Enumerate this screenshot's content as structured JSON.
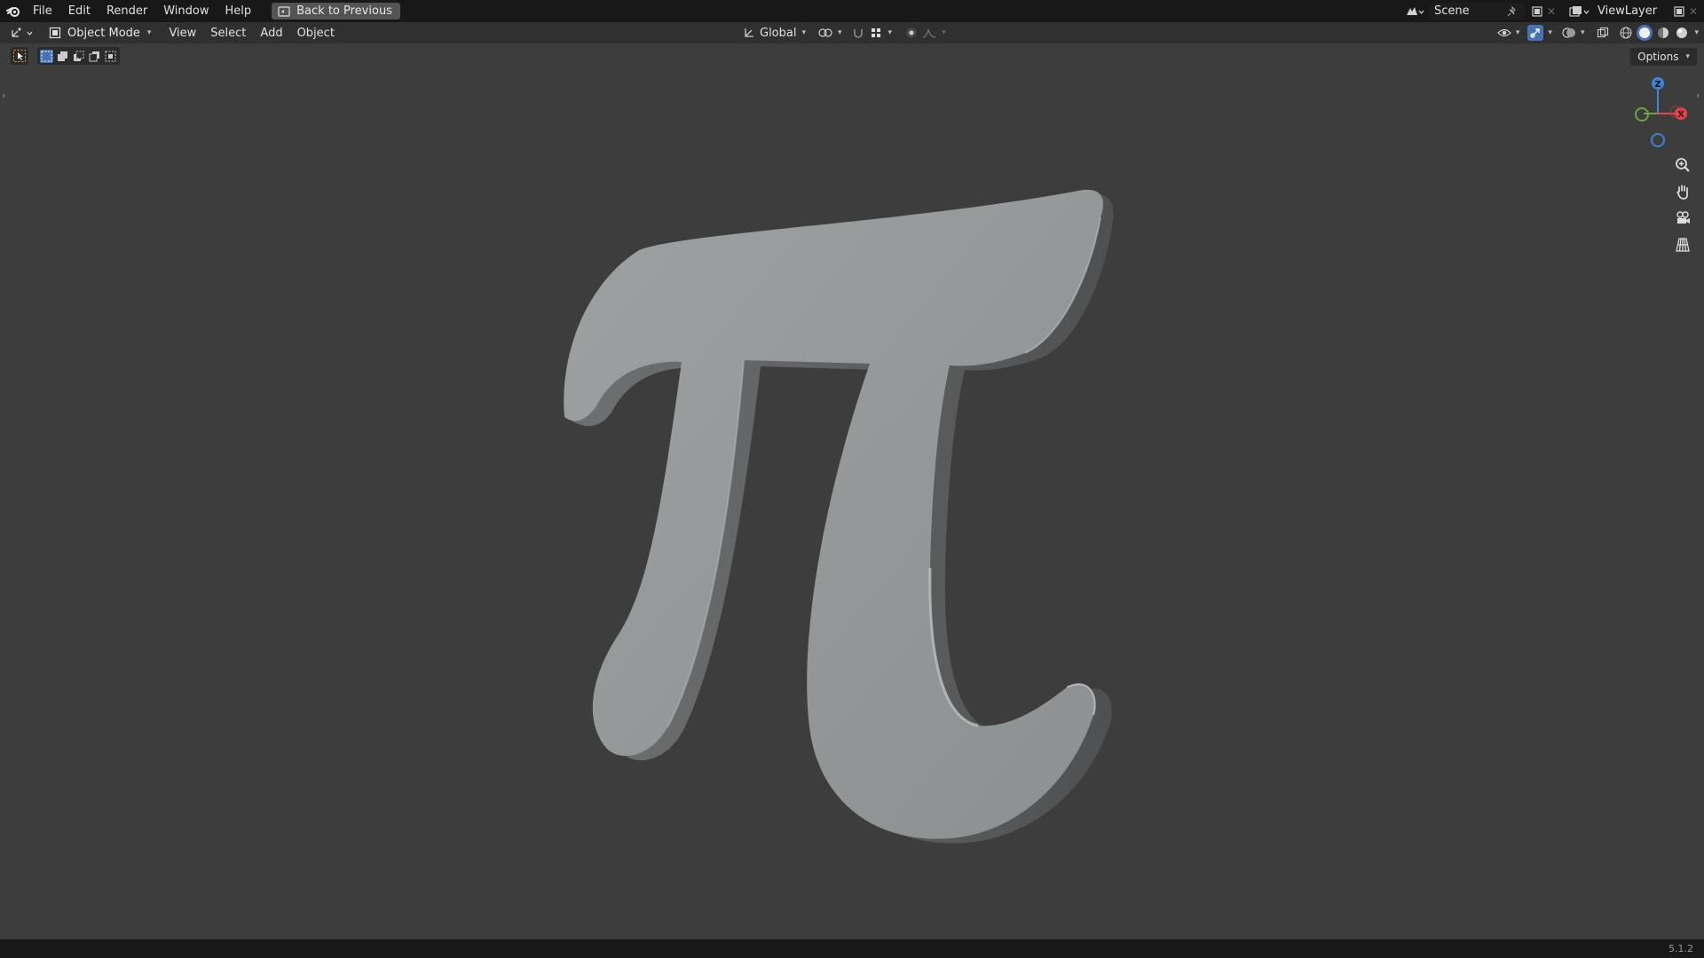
{
  "topbar": {
    "menus": [
      "File",
      "Edit",
      "Render",
      "Window",
      "Help"
    ],
    "back_button": "Back to Previous",
    "scene_name": "Scene",
    "view_layer_name": "ViewLayer"
  },
  "header": {
    "mode": "Object Mode",
    "menus": [
      "View",
      "Select",
      "Add",
      "Object"
    ],
    "transform_orientation": "Global"
  },
  "viewport": {
    "options_label": "Options",
    "object_icon": "pi-symbol-3d-text",
    "gizmo_axes": {
      "z": "Z",
      "x": "X"
    }
  },
  "status": {
    "version": "5.1.2"
  },
  "colors": {
    "viewport_bg": "#3d3d3d",
    "topbar_bg": "#181818",
    "header_bg": "#303030",
    "accent_blue": "#4772b3",
    "axis_x": "#e8424b",
    "axis_y": "#6ca43d",
    "axis_z": "#3e83d6"
  }
}
